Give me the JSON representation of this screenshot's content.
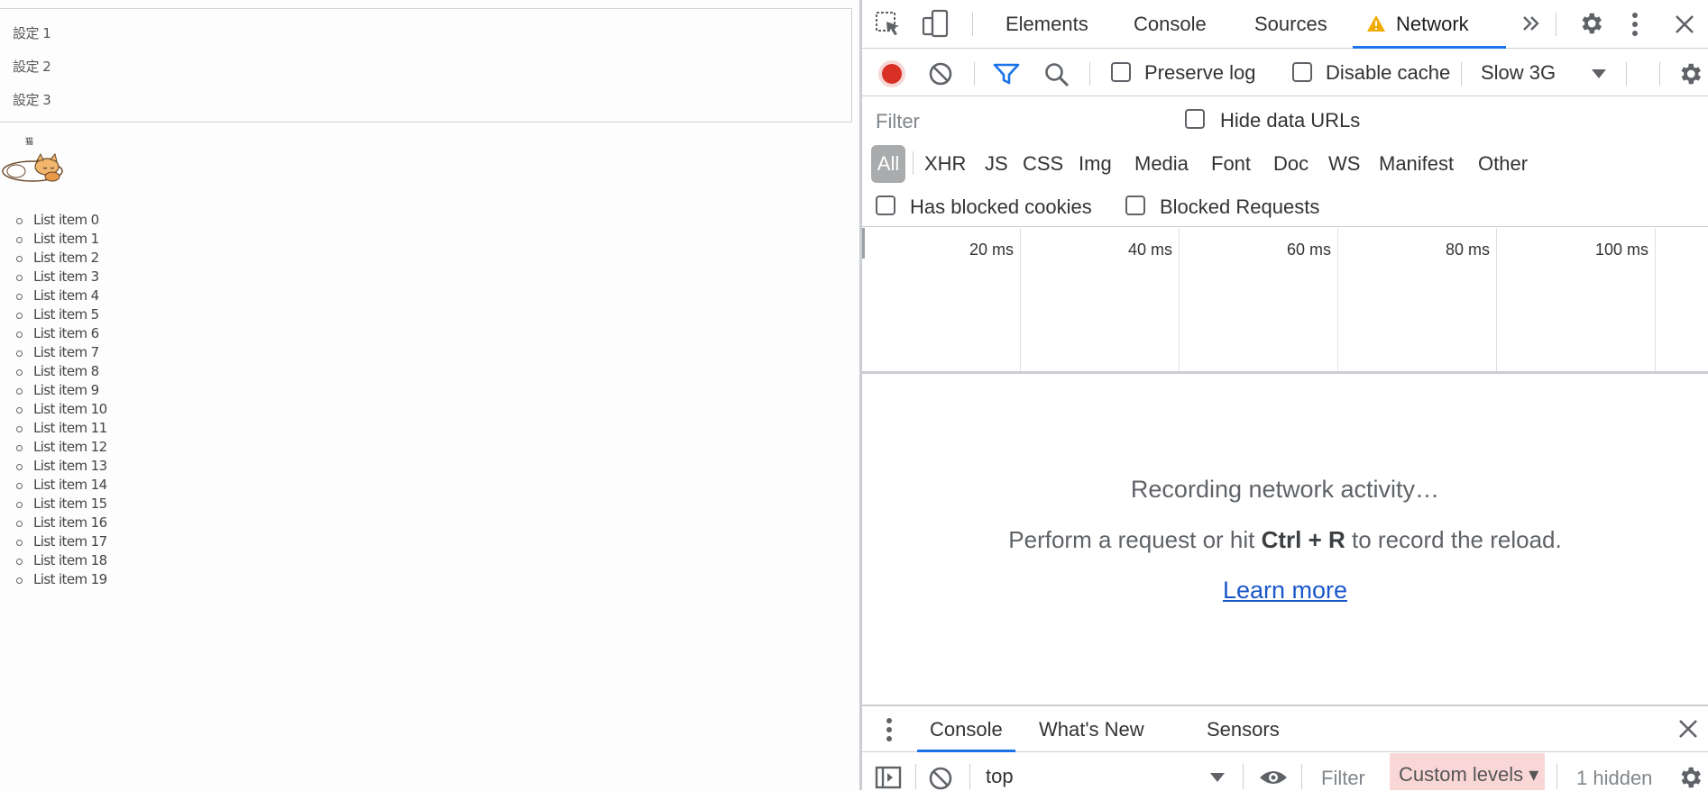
{
  "page": {
    "settings": [
      "設定 1",
      "設定 2",
      "設定 3"
    ],
    "cat_label": "猫",
    "list_items": [
      "List item 0",
      "List item 1",
      "List item 2",
      "List item 3",
      "List item 4",
      "List item 5",
      "List item 6",
      "List item 7",
      "List item 8",
      "List item 9",
      "List item 10",
      "List item 11",
      "List item 12",
      "List item 13",
      "List item 14",
      "List item 15",
      "List item 16",
      "List item 17",
      "List item 18",
      "List item 19"
    ]
  },
  "devtools": {
    "tabs": [
      "Elements",
      "Console",
      "Sources",
      "Network"
    ],
    "active_tab": "Network",
    "toolbar": {
      "preserve_log": "Preserve log",
      "disable_cache": "Disable cache",
      "throttling": "Slow 3G"
    },
    "filter": {
      "placeholder": "Filter",
      "hide_data_urls": "Hide data URLs",
      "types": [
        "All",
        "XHR",
        "JS",
        "CSS",
        "Img",
        "Media",
        "Font",
        "Doc",
        "WS",
        "Manifest",
        "Other"
      ],
      "has_blocked_cookies": "Has blocked cookies",
      "blocked_requests": "Blocked Requests"
    },
    "timeline_ticks": [
      "20 ms",
      "40 ms",
      "60 ms",
      "80 ms",
      "100 ms"
    ],
    "empty_state": {
      "title": "Recording network activity…",
      "hint_before": "Perform a request or hit ",
      "hint_keys": "Ctrl + R",
      "hint_after": " to record the reload.",
      "learn_more": "Learn more"
    },
    "drawer": {
      "tabs": [
        "Console",
        "What's New",
        "Sensors"
      ],
      "context": "top",
      "filter_placeholder": "Filter",
      "levels": "Custom levels",
      "hidden_count": "1 hidden"
    },
    "colors": {
      "accent": "#1a73e8",
      "record": "#d93025",
      "warning": "#f2ab00",
      "custom_levels_bg": "#fad7d7"
    },
    "icons": [
      "inspect-icon",
      "device-toolbar-icon",
      "warning-icon",
      "more-tabs-icon",
      "settings-icon",
      "kebab-icon",
      "close-icon",
      "record-icon",
      "clear-icon",
      "filter-icon",
      "search-icon",
      "dropdown-arrow-icon",
      "settings-icon",
      "sidebar-toggle-icon",
      "eye-icon"
    ]
  }
}
